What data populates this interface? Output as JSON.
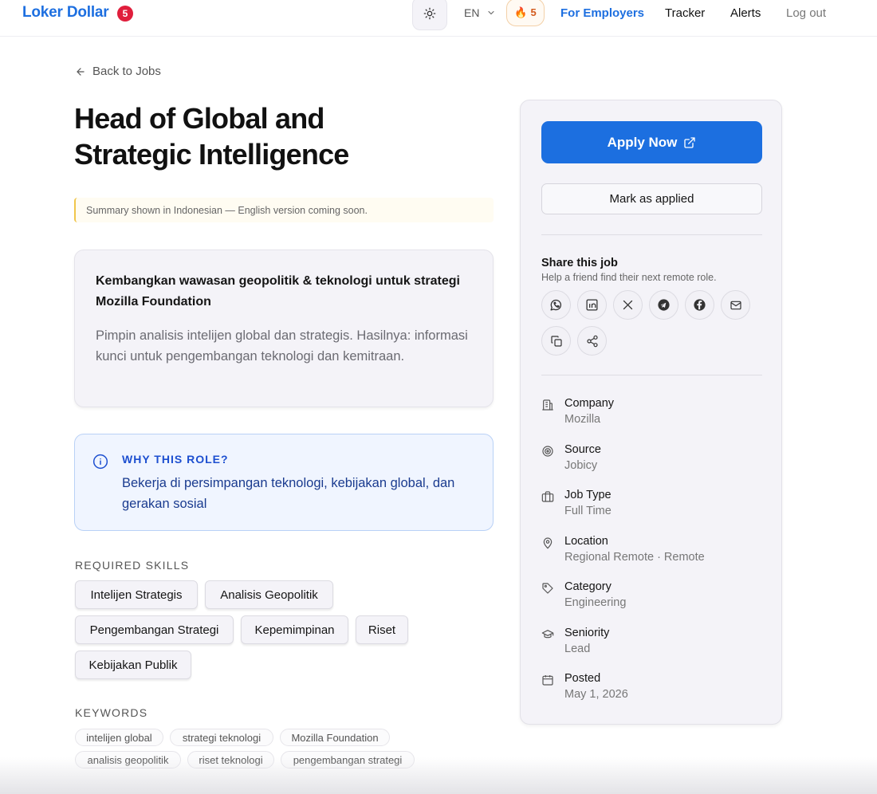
{
  "header": {
    "brand": "Loker Dollar",
    "notification_count": "5",
    "language": "EN",
    "streak_count": "5",
    "nav": {
      "employers": "For Employers",
      "tracker": "Tracker",
      "alerts": "Alerts",
      "logout": "Log out"
    }
  },
  "job": {
    "back_label": "Back to Jobs",
    "title": "Head of Global and Strategic Intelligence",
    "notice": "Summary shown in Indonesian — English version coming soon.",
    "summary_heading": "Kembangkan wawasan geopolitik & teknologi untuk strategi Mozilla Foundation",
    "summary_body": "Pimpin analisis intelijen global dan strategis. Hasilnya: informasi kunci untuk pengembangan teknologi dan kemitraan.",
    "why_label": "WHY THIS ROLE?",
    "why_text": "Bekerja di persimpangan teknologi, kebijakan global, dan gerakan sosial",
    "skills_label": "REQUIRED SKILLS",
    "skills": [
      "Intelijen Strategis",
      "Analisis Geopolitik",
      "Pengembangan Strategi",
      "Kepemimpinan",
      "Riset",
      "Kebijakan Publik"
    ],
    "keywords_label": "KEYWORDS",
    "keywords": [
      "intelijen global",
      "strategi teknologi",
      "Mozilla Foundation",
      "analisis geopolitik",
      "riset teknologi",
      "pengembangan strategi"
    ]
  },
  "sidebar": {
    "apply_label": "Apply Now",
    "mark_applied_label": "Mark as applied",
    "share_title": "Share this job",
    "share_subtitle": "Help a friend find their next remote role.",
    "share_icons": [
      "whatsapp-icon",
      "linkedin-icon",
      "x-icon",
      "telegram-icon",
      "facebook-icon",
      "email-icon",
      "copy-icon",
      "share-icon"
    ],
    "meta": [
      {
        "label": "Company",
        "value": "Mozilla",
        "icon": "building-icon"
      },
      {
        "label": "Source",
        "value": "Jobicy",
        "icon": "target-icon"
      },
      {
        "label": "Job Type",
        "value": "Full Time",
        "icon": "briefcase-icon"
      },
      {
        "label": "Location",
        "value": "Regional Remote · Remote",
        "icon": "map-pin-icon"
      },
      {
        "label": "Category",
        "value": "Engineering",
        "icon": "tag-icon"
      },
      {
        "label": "Seniority",
        "value": "Lead",
        "icon": "graduation-cap-icon"
      },
      {
        "label": "Posted",
        "value": "May 1, 2026",
        "icon": "calendar-icon"
      }
    ]
  },
  "colors": {
    "brand": "#1d6fe0",
    "badge": "#e01e3c",
    "why_text": "#1a3b8f",
    "streak": "#d35a1c"
  }
}
